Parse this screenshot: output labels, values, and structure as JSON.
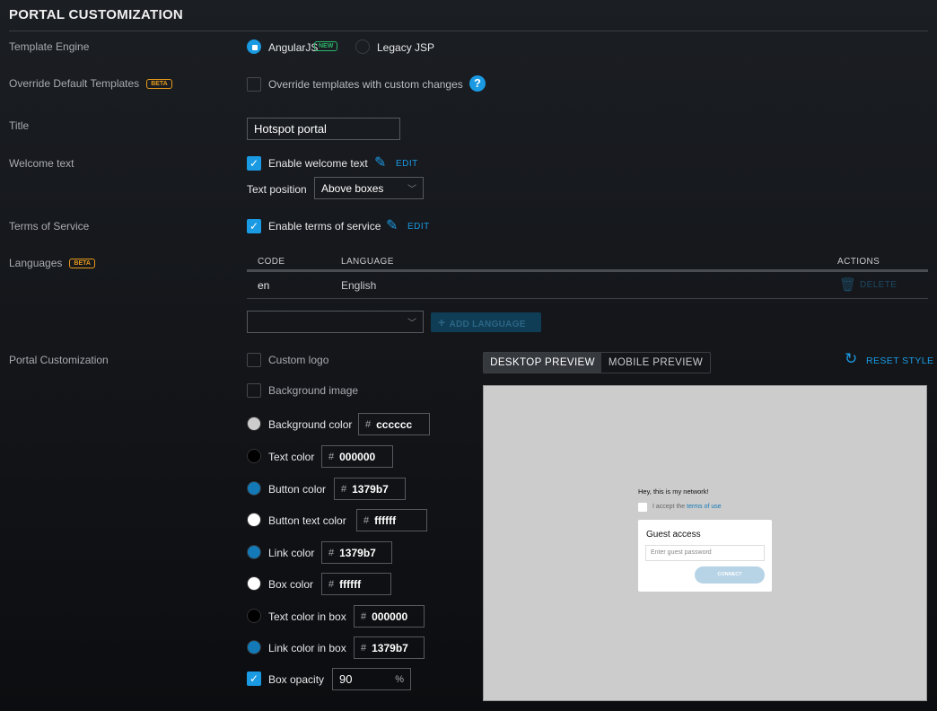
{
  "header": {
    "title": "PORTAL CUSTOMIZATION"
  },
  "template_engine": {
    "label": "Template Engine",
    "options": [
      {
        "label": "AngularJS",
        "badge": "NEW",
        "selected": true
      },
      {
        "label": "Legacy JSP",
        "selected": false
      }
    ]
  },
  "override": {
    "label": "Override Default Templates",
    "badge": "BETA",
    "checkbox_label": "Override templates with custom changes",
    "checked": false,
    "help_icon": "question-icon"
  },
  "title": {
    "label": "Title",
    "value": "Hotspot portal"
  },
  "welcome": {
    "label": "Welcome text",
    "checkbox_label": "Enable welcome text",
    "checked": true,
    "edit": "EDIT",
    "position_label": "Text position",
    "position_value": "Above boxes"
  },
  "tos": {
    "label": "Terms of Service",
    "checkbox_label": "Enable terms of service",
    "checked": true,
    "edit": "EDIT"
  },
  "languages": {
    "label": "Languages",
    "badge": "BETA",
    "columns": [
      "CODE",
      "LANGUAGE",
      "ACTIONS"
    ],
    "rows": [
      {
        "code": "en",
        "language": "English",
        "action": "DELETE"
      }
    ],
    "add_label": "ADD LANGUAGE",
    "select_value": ""
  },
  "portal": {
    "label": "Portal Customization",
    "custom_logo": "Custom logo",
    "background_image": "Background image",
    "colors": [
      {
        "label": "Background color",
        "value": "cccccc",
        "swatch": "#cccccc"
      },
      {
        "label": "Text color",
        "value": "000000",
        "swatch": "#000000"
      },
      {
        "label": "Button color",
        "value": "1379b7",
        "swatch": "#1379b7"
      },
      {
        "label": "Button text color",
        "value": "ffffff",
        "swatch": "#ffffff"
      },
      {
        "label": "Link color",
        "value": "1379b7",
        "swatch": "#1379b7"
      },
      {
        "label": "Box color",
        "value": "ffffff",
        "swatch": "#ffffff"
      },
      {
        "label": "Text color in box",
        "value": "000000",
        "swatch": "#000000"
      },
      {
        "label": "Link color in box",
        "value": "1379b7",
        "swatch": "#1379b7"
      }
    ],
    "hash": "#",
    "opacity": {
      "label": "Box opacity",
      "value": "90",
      "unit": "%",
      "checked": true
    }
  },
  "preview": {
    "tabs": [
      "DESKTOP PREVIEW",
      "MOBILE PREVIEW"
    ],
    "active": 0,
    "reset": "RESET STYLE",
    "welcome": "Hey, this is my network!",
    "accept": "I accept the ",
    "terms_link": "terms of use",
    "box_title": "Guest access",
    "password_placeholder": "Enter guest password",
    "connect": "CONNECT"
  }
}
